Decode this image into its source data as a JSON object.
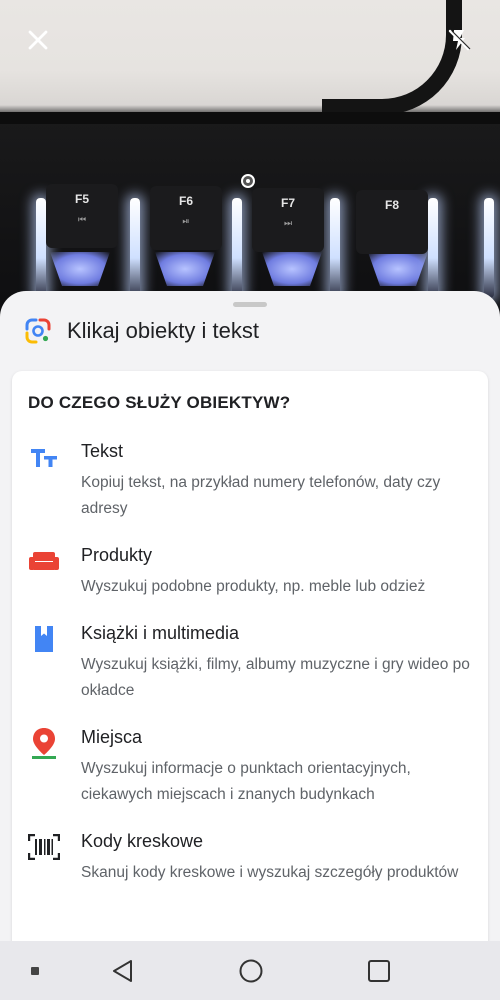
{
  "camera": {
    "close_icon": "close-icon",
    "flash_icon": "flash-off-icon",
    "keys": [
      {
        "label": "F5",
        "sub": "⏮"
      },
      {
        "label": "F6",
        "sub": "⏯"
      },
      {
        "label": "F7",
        "sub": "⏭"
      },
      {
        "label": "F8",
        "sub": ""
      }
    ]
  },
  "sheet": {
    "title": "Klikaj obiekty i tekst",
    "card_heading": "DO CZEGO SŁUŻY OBIEKTYW?",
    "items": [
      {
        "title": "Tekst",
        "desc": "Kopiuj tekst, na przykład numery telefonów, daty czy adresy",
        "icon": "text-icon",
        "color": "#4285f4"
      },
      {
        "title": "Produkty",
        "desc": "Wyszukuj podobne produkty, np. meble lub odzież",
        "icon": "sofa-icon",
        "color": "#ea4335"
      },
      {
        "title": "Książki i multimedia",
        "desc": "Wyszukuj książki, filmy, albumy muzyczne i gry wideo po okładce",
        "icon": "book-icon",
        "color": "#4285f4"
      },
      {
        "title": "Miejsca",
        "desc": "Wyszukuj informacje o punktach orientacyjnych, ciekawych miejscach i znanych budynkach",
        "icon": "place-pin-icon",
        "color": "#ea4335"
      },
      {
        "title": "Kody kreskowe",
        "desc": "Skanuj kody kreskowe i wyszukaj szczegóły produktów",
        "icon": "barcode-icon",
        "color": "#202124"
      }
    ]
  },
  "navbar": {
    "items": [
      "square-small-icon",
      "back-icon",
      "home-icon",
      "recents-icon"
    ]
  }
}
